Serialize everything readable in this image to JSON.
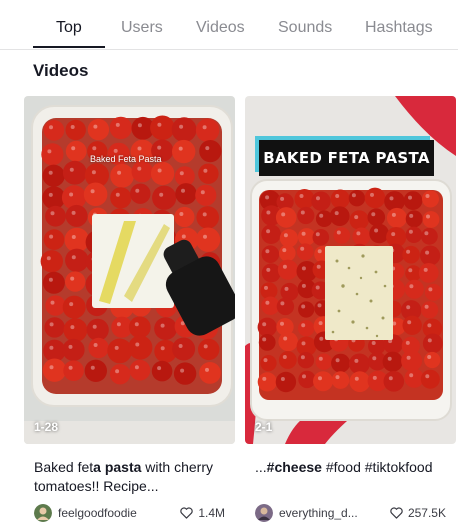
{
  "tabs": [
    {
      "label": "Top",
      "active": true
    },
    {
      "label": "Users",
      "active": false
    },
    {
      "label": "Videos",
      "active": false
    },
    {
      "label": "Sounds",
      "active": false
    },
    {
      "label": "Hashtags",
      "active": false
    }
  ],
  "section_title": "Videos",
  "videos": [
    {
      "overlay_text": "Baked Feta Pasta",
      "views": "1-28",
      "caption_parts": [
        "Baked fet",
        "a",
        " ",
        "pasta",
        " with cherry tomatoes!! Recipe..."
      ],
      "author": "feelgoodfoodie",
      "likes": "1.4M",
      "avatar_icon": "avatar-icon"
    },
    {
      "overlay_text": "BAKED FETA PASTA",
      "views": "2-1",
      "caption_parts": [
        "...",
        "#cheese",
        " #food #tiktokfood"
      ],
      "author": "everything_d...",
      "likes": "257.5K",
      "avatar_icon": "avatar-icon"
    }
  ],
  "colors": {
    "text_primary": "#161823",
    "text_secondary": "#8a8b91",
    "banner_accent": "#4fc6db",
    "tomato": "#c7261b",
    "feta": "#f2f0e6"
  }
}
